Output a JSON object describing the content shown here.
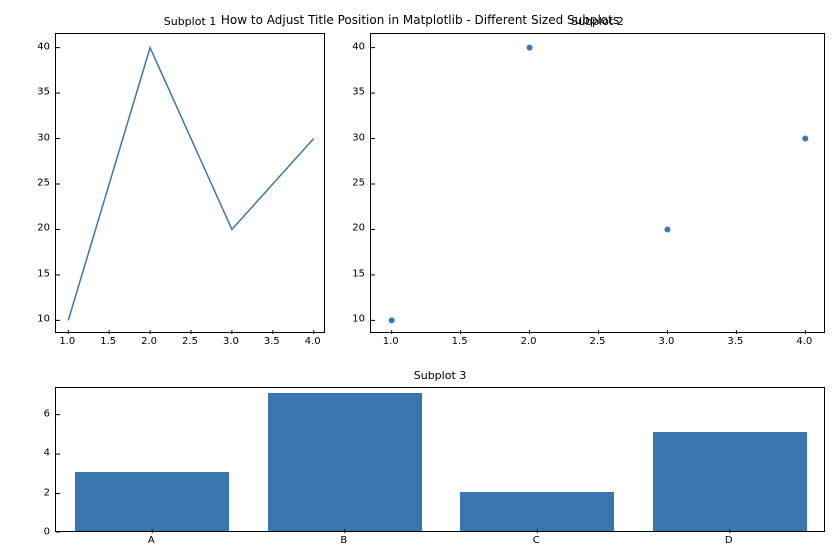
{
  "suptitle": "How to Adjust Title Position in Matplotlib - Different Sized Subplots",
  "subplots": {
    "ax1_title": "Subplot 1",
    "ax2_title": "Subplot 2",
    "ax3_title": "Subplot 3"
  },
  "ax1": {
    "xticks": [
      "1.0",
      "1.5",
      "2.0",
      "2.5",
      "3.0",
      "3.5",
      "4.0"
    ],
    "yticks": [
      "10",
      "15",
      "20",
      "25",
      "30",
      "35",
      "40"
    ]
  },
  "ax2": {
    "xticks": [
      "1.0",
      "1.5",
      "2.0",
      "2.5",
      "3.0",
      "3.5",
      "4.0"
    ],
    "yticks": [
      "10",
      "15",
      "20",
      "25",
      "30",
      "35",
      "40"
    ]
  },
  "ax3": {
    "xticks": [
      "A",
      "B",
      "C",
      "D"
    ],
    "yticks": [
      "0",
      "2",
      "4",
      "6"
    ]
  },
  "chart_data": [
    {
      "type": "line",
      "title": "Subplot 1",
      "x": [
        1,
        2,
        3,
        4
      ],
      "y": [
        10,
        40,
        20,
        30
      ],
      "xlim": [
        0.85,
        4.15
      ],
      "ylim": [
        8.5,
        41.5
      ],
      "xticks": [
        1.0,
        1.5,
        2.0,
        2.5,
        3.0,
        3.5,
        4.0
      ],
      "yticks": [
        10,
        15,
        20,
        25,
        30,
        35,
        40
      ]
    },
    {
      "type": "scatter",
      "title": "Subplot 2",
      "x": [
        1,
        2,
        3,
        4
      ],
      "y": [
        10,
        40,
        20,
        30
      ],
      "xlim": [
        0.85,
        4.15
      ],
      "ylim": [
        8.5,
        41.5
      ],
      "xticks": [
        1.0,
        1.5,
        2.0,
        2.5,
        3.0,
        3.5,
        4.0
      ],
      "yticks": [
        10,
        15,
        20,
        25,
        30,
        35,
        40
      ]
    },
    {
      "type": "bar",
      "title": "Subplot 3",
      "categories": [
        "A",
        "B",
        "C",
        "D"
      ],
      "values": [
        3,
        7,
        2,
        5
      ],
      "ylim": [
        0,
        7.35
      ],
      "yticks": [
        0,
        2,
        4,
        6
      ]
    }
  ]
}
